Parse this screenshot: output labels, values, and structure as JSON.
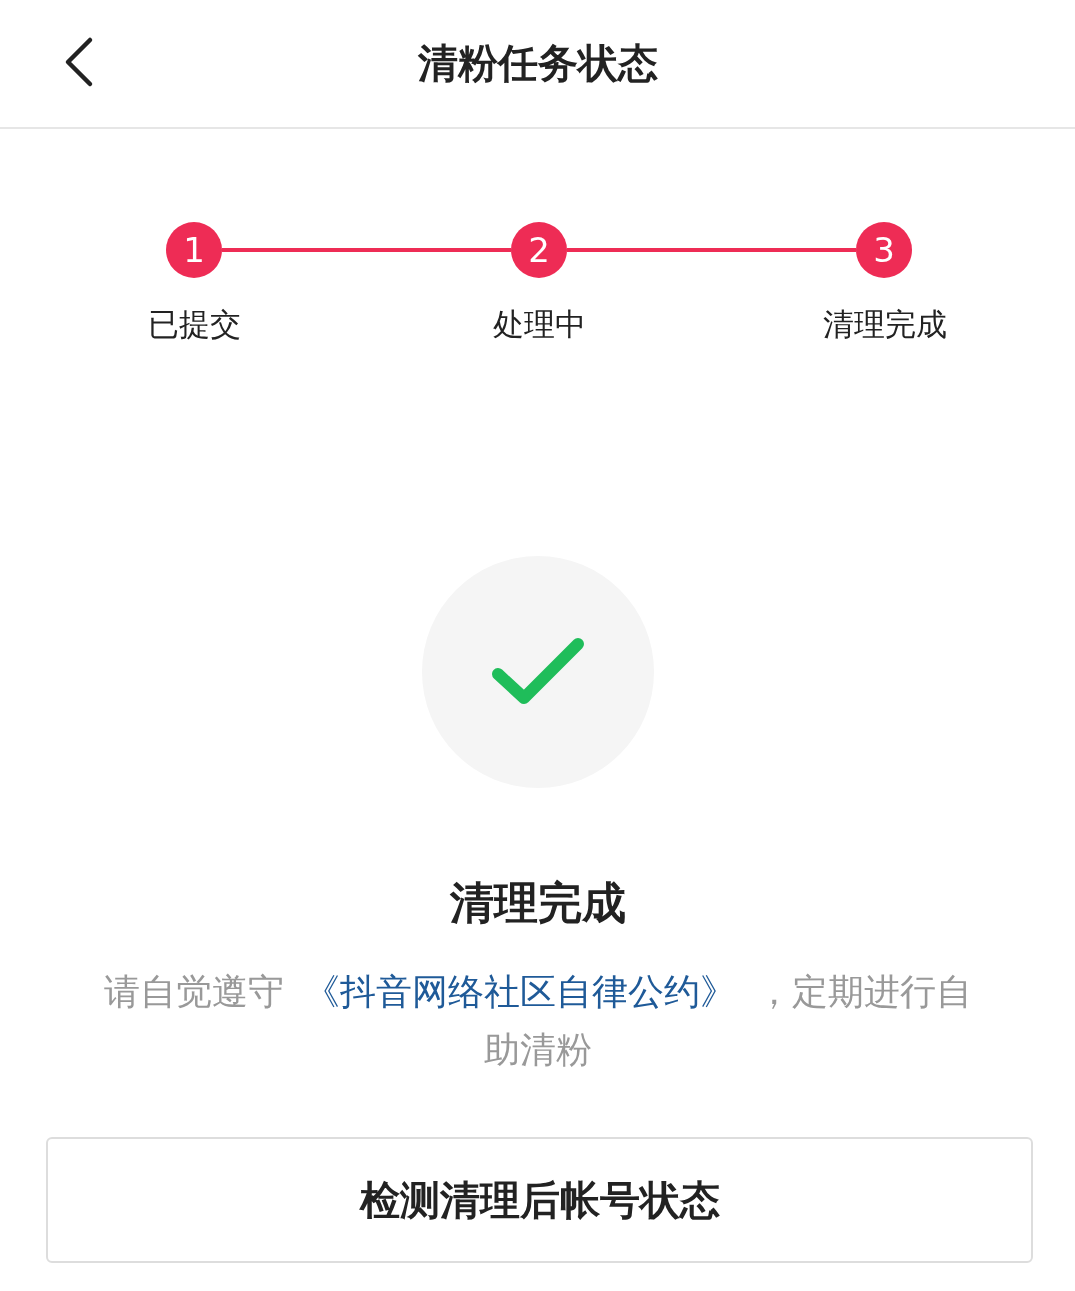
{
  "header": {
    "title": "清粉任务状态"
  },
  "steps": [
    {
      "number": "1",
      "label": "已提交",
      "completed": true
    },
    {
      "number": "2",
      "label": "处理中",
      "completed": true
    },
    {
      "number": "3",
      "label": "清理完成",
      "completed": true
    }
  ],
  "result": {
    "title": "清理完成",
    "notice_before": "请自觉遵守",
    "notice_link": "《抖音网络社区自律公约》",
    "notice_after": "，定期进行自助清粉"
  },
  "button": {
    "label": "检测清理后帐号状态"
  }
}
